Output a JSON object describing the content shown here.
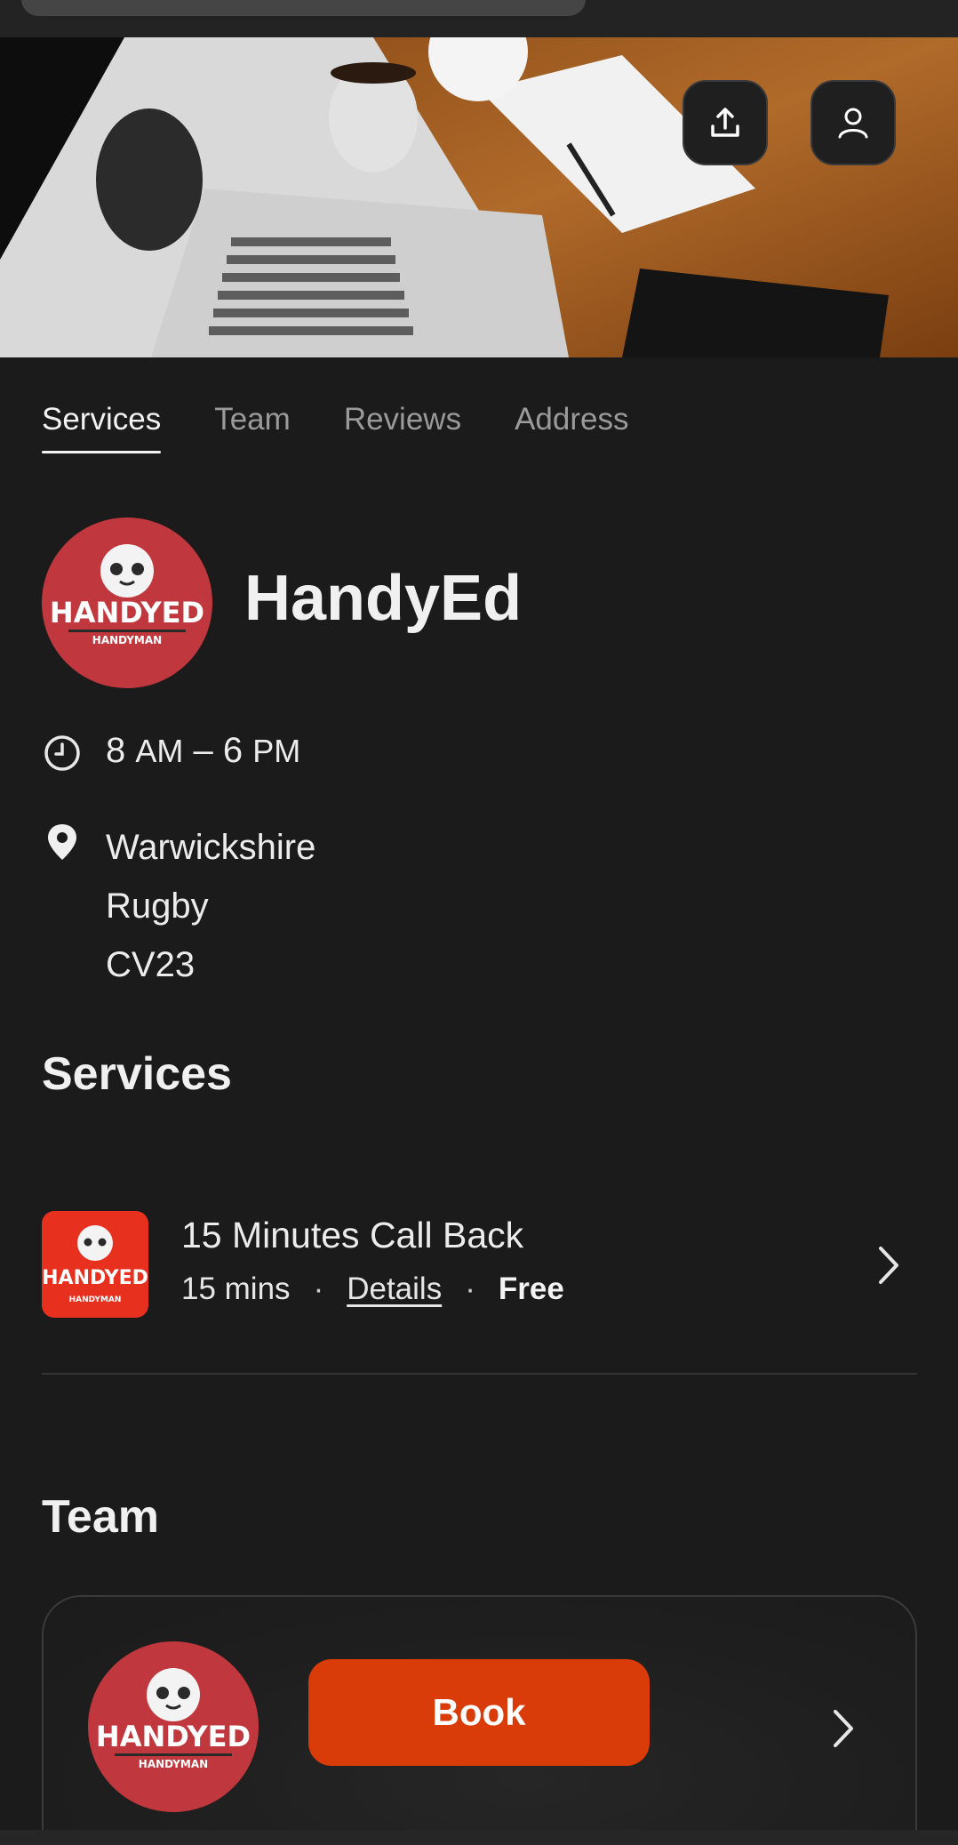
{
  "tabs": [
    {
      "label": "Services",
      "active": true
    },
    {
      "label": "Team",
      "active": false
    },
    {
      "label": "Reviews",
      "active": false
    },
    {
      "label": "Address",
      "active": false
    }
  ],
  "business": {
    "name": "HandyEd",
    "logo_text": "HANDYED",
    "logo_subtext": "HANDYMAN",
    "hours": {
      "open_num": "8",
      "open_ampm": "AM",
      "sep": "–",
      "close_num": "6",
      "close_ampm": "PM"
    },
    "address": [
      "Warwickshire",
      "Rugby",
      "CV23"
    ]
  },
  "services_section": {
    "title": "Services",
    "items": [
      {
        "name": "15 Minutes Call Back",
        "duration": "15 mins",
        "details_label": "Details",
        "price": "Free",
        "dot": "·"
      }
    ]
  },
  "team_section": {
    "title": "Team",
    "book_label": "Book"
  },
  "icons": {
    "share": "share-upload-icon",
    "profile": "user-icon",
    "clock": "clock-icon",
    "location": "map-pin-icon",
    "chevron": "chevron-right-icon"
  },
  "colors": {
    "background": "#1b1b1b",
    "book_button": "#d93c08",
    "logo_red": "#c0383d",
    "thumb_red": "#e8301f"
  }
}
